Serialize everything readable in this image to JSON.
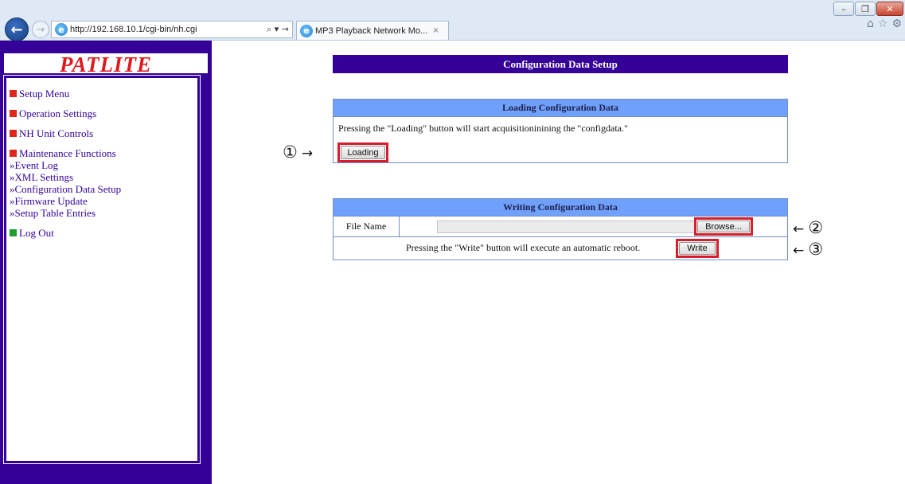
{
  "browser": {
    "url": "http://192.168.10.1/cgi-bin/nh.cgi",
    "address_controls": "⌕ ▾ →",
    "tab_title": "MP3 Playback Network Mo...",
    "tab_close": "×",
    "window_buttons": [
      "–",
      "❐",
      "✕"
    ],
    "right_icons": [
      "⌂",
      "☆",
      "⚙"
    ]
  },
  "sidebar": {
    "brand": "PATLITE",
    "menu": {
      "setup_menu": "Setup Menu",
      "operation_settings": "Operation Settings",
      "nh_unit_controls": "NH Unit Controls",
      "maintenance_functions": "Maintenance Functions",
      "sub_items": [
        "»Event Log",
        "»XML Settings",
        "»Configuration Data Setup",
        "»Firmware Update",
        "»Setup Table Entries"
      ],
      "log_out": "Log Out"
    }
  },
  "main": {
    "title": "Configuration Data Setup",
    "loading": {
      "header": "Loading Configuration Data",
      "description": "Pressing the \"Loading\" button will start acquisitioninining the \"configdata.\"",
      "button": "Loading"
    },
    "writing": {
      "header": "Writing Configuration Data",
      "file_label": "File Name",
      "browse_button": "Browse...",
      "description": "Pressing the \"Write\" button will execute an automatic reboot.",
      "write_button": "Write"
    }
  },
  "annotations": {
    "marker_1": "①",
    "marker_2": "②",
    "marker_3": "③",
    "arrow_right": "→",
    "arrow_left": "←",
    "highlight_color": "#d61f2b"
  },
  "colors": {
    "sidebar_bg": "#350098",
    "brand_red": "#e0191e",
    "panel_header_blue": "#6fa0fb",
    "bullet_red": "#e0251b",
    "bullet_green": "#1f9e2b"
  }
}
